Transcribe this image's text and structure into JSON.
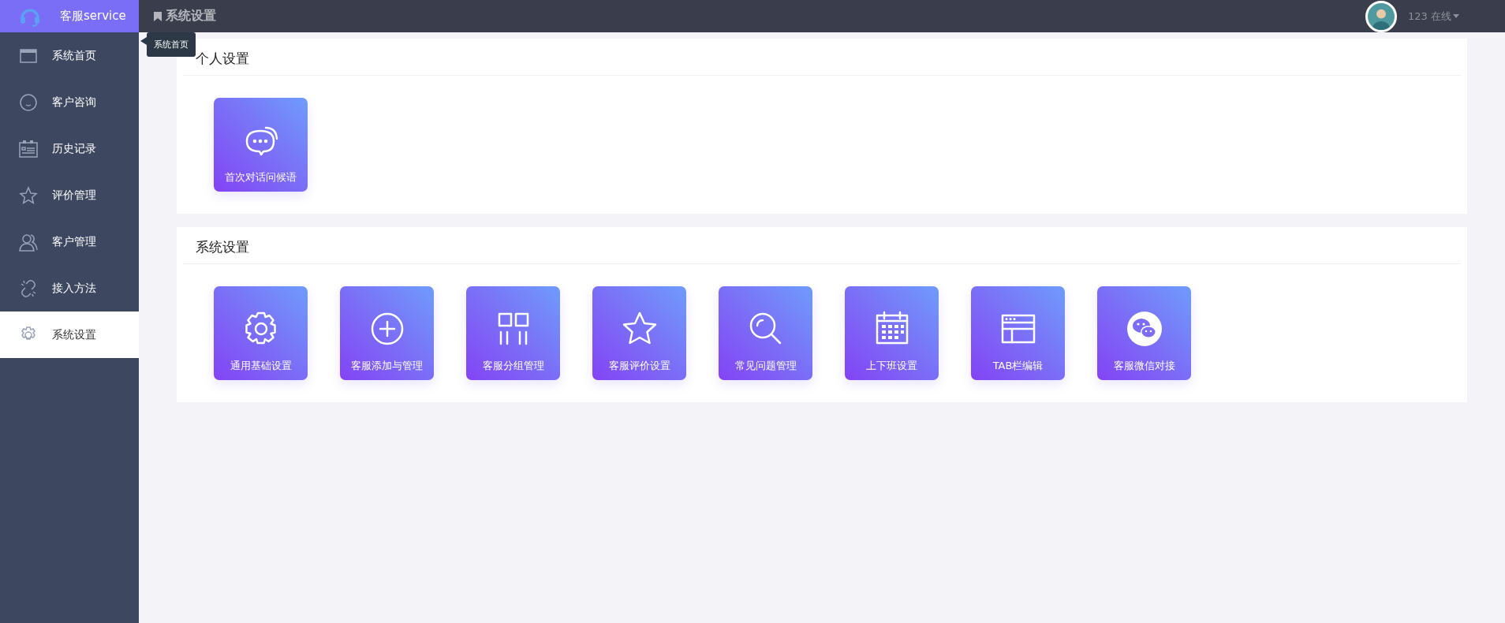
{
  "brand": {
    "title": "客服service"
  },
  "sidebar": {
    "items": [
      {
        "label": "系统首页",
        "selected": false
      },
      {
        "label": "客户咨询",
        "selected": false
      },
      {
        "label": "历史记录",
        "selected": false
      },
      {
        "label": "评价管理",
        "selected": false
      },
      {
        "label": "客户管理",
        "selected": false
      },
      {
        "label": "接入方法",
        "selected": false
      },
      {
        "label": "系统设置",
        "selected": true
      }
    ]
  },
  "tooltip": {
    "text": "系统首页"
  },
  "header": {
    "title": "系统设置",
    "user": "123",
    "status": "在线"
  },
  "sections": [
    {
      "title": "个人设置",
      "cards": [
        {
          "label": "首次对话问候语"
        }
      ]
    },
    {
      "title": "系统设置",
      "cards": [
        {
          "label": "通用基础设置"
        },
        {
          "label": "客服添加与管理"
        },
        {
          "label": "客服分组管理"
        },
        {
          "label": "客服评价设置"
        },
        {
          "label": "常见问题管理"
        },
        {
          "label": "上下班设置"
        },
        {
          "label": "TAB栏编辑"
        },
        {
          "label": "客服微信对接"
        }
      ]
    }
  ]
}
